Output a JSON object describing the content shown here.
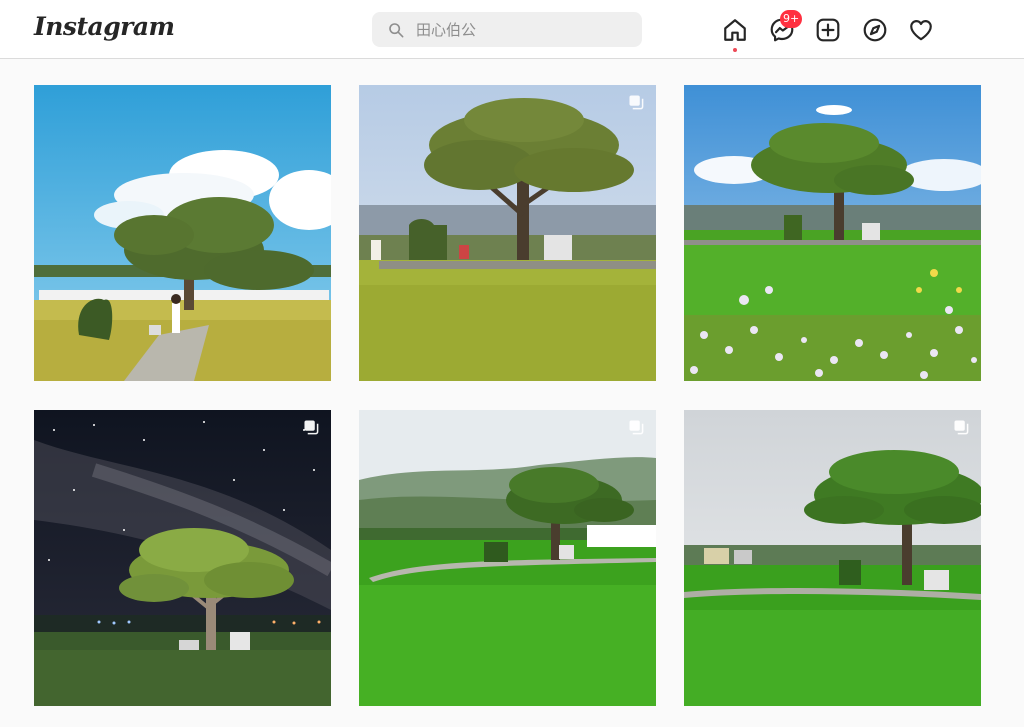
{
  "header": {
    "logo_text": "Instagram",
    "search": {
      "placeholder": "田心伯公"
    },
    "nav": [
      {
        "name": "home-icon",
        "active": true
      },
      {
        "name": "messenger-icon",
        "badge": "9+"
      },
      {
        "name": "new-post-icon"
      },
      {
        "name": "explore-icon"
      },
      {
        "name": "activity-heart-icon"
      }
    ]
  },
  "colors": {
    "badge": "#ff3040",
    "home_dot": "#ed4956",
    "text": "#262626",
    "page_bg": "#fafafa"
  },
  "grid": {
    "posts": [
      {
        "scene": "tree-sunny-field-with-person",
        "multi": false
      },
      {
        "scene": "tree-golden-rice-field",
        "multi": true
      },
      {
        "scene": "tree-wildflowers-field",
        "multi": false
      },
      {
        "scene": "tree-milky-way-night",
        "multi": true
      },
      {
        "scene": "tree-green-paddy-hills",
        "multi": true
      },
      {
        "scene": "tree-green-paddy-cloudy",
        "multi": true
      }
    ]
  }
}
